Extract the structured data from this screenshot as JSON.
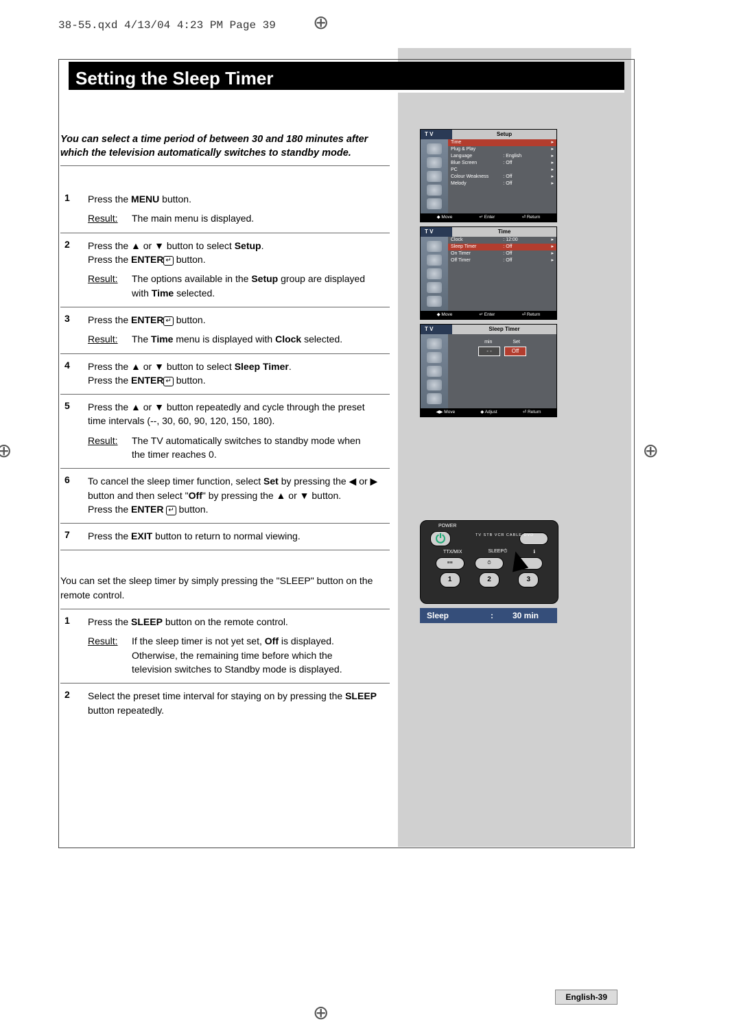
{
  "slug": "38-55.qxd  4/13/04 4:23 PM  Page 39",
  "title": "Setting the Sleep Timer",
  "intro": "You can select a time period of between 30 and 180 minutes after which the television automatically switches to standby mode.",
  "steps_a": [
    {
      "num": "1",
      "body_html": "Press the <b>MENU</b> button.",
      "result_html": "The main menu is displayed."
    },
    {
      "num": "2",
      "body_html": "Press the ▲ or ▼ button to select <b>Setup</b>.<br>Press the <b>ENTER</b><span class='enter-icon'>↵</span> button.",
      "result_html": "The options available in the <b>Setup</b> group are displayed with <b>Time</b> selected."
    },
    {
      "num": "3",
      "body_html": "Press the <b>ENTER</b><span class='enter-icon'>↵</span> button.",
      "result_html": "The <b>Time</b> menu is displayed with <b>Clock</b> selected."
    },
    {
      "num": "4",
      "body_html": "Press the ▲ or ▼ button to select <b>Sleep Timer</b>.<br>Press the <b>ENTER</b><span class='enter-icon'>↵</span> button.",
      "result_html": null
    },
    {
      "num": "5",
      "body_html": "Press the ▲ or ▼ button repeatedly and cycle through the preset time intervals (--, 30, 60, 90, 120, 150, 180).",
      "result_html": "The TV automatically switches to standby mode when the timer reaches 0."
    },
    {
      "num": "6",
      "body_html": "To cancel the sleep timer function, select <b>Set</b> by pressing the ◀ or ▶ button and then select \"<b>Off</b>\" by pressing the ▲ or ▼ button.<br>Press the <b>ENTER</b> <span class='enter-icon'>↵</span> button.",
      "result_html": null
    },
    {
      "num": "7",
      "body_html": "Press the <b>EXIT</b> button to return to normal viewing.",
      "result_html": null
    }
  ],
  "note": "You can set the sleep timer by simply pressing the \"SLEEP\" button on the remote control.",
  "steps_b": [
    {
      "num": "1",
      "body_html": "Press the <b>SLEEP</b> button on the remote control.",
      "result_html": "If the sleep timer is not yet set, <b>Off</b> is displayed. Otherwise, the remaining time before which the television switches to Standby mode is displayed."
    },
    {
      "num": "2",
      "body_html": "Select the preset time interval for staying on by pressing the <b>SLEEP</b> button repeatedly.",
      "result_html": null
    }
  ],
  "result_label": "Result:",
  "osd": {
    "tv": "T V",
    "setup": {
      "title": "Setup",
      "items": [
        {
          "k": "Time",
          "v": "",
          "hi": true
        },
        {
          "k": "Plug & Play",
          "v": ""
        },
        {
          "k": "Language",
          "v": "English"
        },
        {
          "k": "Blue Screen",
          "v": "Off"
        },
        {
          "k": "PC",
          "v": ""
        },
        {
          "k": "Colour Weakness",
          "v": "Off"
        },
        {
          "k": "Melody",
          "v": "Off"
        }
      ],
      "foot": [
        "◆ Move",
        "↵ Enter",
        "⏎ Return"
      ]
    },
    "time": {
      "title": "Time",
      "items": [
        {
          "k": "Clock",
          "v": "12:00"
        },
        {
          "k": "Sleep Timer",
          "v": "Off",
          "hi": true
        },
        {
          "k": "On Timer",
          "v": "Off"
        },
        {
          "k": "Off Timer",
          "v": "Off"
        }
      ],
      "foot": [
        "◆ Move",
        "↵ Enter",
        "⏎ Return"
      ]
    },
    "sleep": {
      "title": "Sleep Timer",
      "min_label": "min",
      "set_label": "Set",
      "min_val": "- -",
      "set_val": "Off",
      "foot": [
        "◀▶ Move",
        "◆ Adjust",
        "⏎ Return"
      ]
    }
  },
  "remote": {
    "power": "POWER",
    "sources": "TV  STB  VCR  CABLE  DVD",
    "ttx": "TTX/MIX",
    "sleep": "SLEEP⏱",
    "nums": [
      "1",
      "2",
      "3"
    ]
  },
  "sleep_status": {
    "label": "Sleep",
    "sep": ":",
    "value": "30 min"
  },
  "page_number": "English-39",
  "crop_glyph": "⊕"
}
